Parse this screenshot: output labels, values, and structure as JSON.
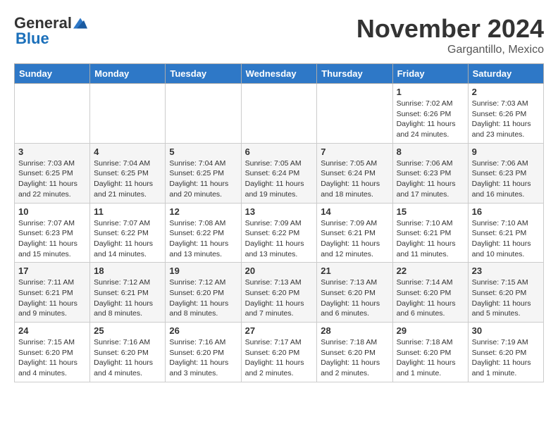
{
  "header": {
    "logo_general": "General",
    "logo_blue": "Blue",
    "month_title": "November 2024",
    "location": "Gargantillo, Mexico"
  },
  "days_of_week": [
    "Sunday",
    "Monday",
    "Tuesday",
    "Wednesday",
    "Thursday",
    "Friday",
    "Saturday"
  ],
  "weeks": [
    [
      {
        "day": "",
        "info": ""
      },
      {
        "day": "",
        "info": ""
      },
      {
        "day": "",
        "info": ""
      },
      {
        "day": "",
        "info": ""
      },
      {
        "day": "",
        "info": ""
      },
      {
        "day": "1",
        "info": "Sunrise: 7:02 AM\nSunset: 6:26 PM\nDaylight: 11 hours and 24 minutes."
      },
      {
        "day": "2",
        "info": "Sunrise: 7:03 AM\nSunset: 6:26 PM\nDaylight: 11 hours and 23 minutes."
      }
    ],
    [
      {
        "day": "3",
        "info": "Sunrise: 7:03 AM\nSunset: 6:25 PM\nDaylight: 11 hours and 22 minutes."
      },
      {
        "day": "4",
        "info": "Sunrise: 7:04 AM\nSunset: 6:25 PM\nDaylight: 11 hours and 21 minutes."
      },
      {
        "day": "5",
        "info": "Sunrise: 7:04 AM\nSunset: 6:25 PM\nDaylight: 11 hours and 20 minutes."
      },
      {
        "day": "6",
        "info": "Sunrise: 7:05 AM\nSunset: 6:24 PM\nDaylight: 11 hours and 19 minutes."
      },
      {
        "day": "7",
        "info": "Sunrise: 7:05 AM\nSunset: 6:24 PM\nDaylight: 11 hours and 18 minutes."
      },
      {
        "day": "8",
        "info": "Sunrise: 7:06 AM\nSunset: 6:23 PM\nDaylight: 11 hours and 17 minutes."
      },
      {
        "day": "9",
        "info": "Sunrise: 7:06 AM\nSunset: 6:23 PM\nDaylight: 11 hours and 16 minutes."
      }
    ],
    [
      {
        "day": "10",
        "info": "Sunrise: 7:07 AM\nSunset: 6:23 PM\nDaylight: 11 hours and 15 minutes."
      },
      {
        "day": "11",
        "info": "Sunrise: 7:07 AM\nSunset: 6:22 PM\nDaylight: 11 hours and 14 minutes."
      },
      {
        "day": "12",
        "info": "Sunrise: 7:08 AM\nSunset: 6:22 PM\nDaylight: 11 hours and 13 minutes."
      },
      {
        "day": "13",
        "info": "Sunrise: 7:09 AM\nSunset: 6:22 PM\nDaylight: 11 hours and 13 minutes."
      },
      {
        "day": "14",
        "info": "Sunrise: 7:09 AM\nSunset: 6:21 PM\nDaylight: 11 hours and 12 minutes."
      },
      {
        "day": "15",
        "info": "Sunrise: 7:10 AM\nSunset: 6:21 PM\nDaylight: 11 hours and 11 minutes."
      },
      {
        "day": "16",
        "info": "Sunrise: 7:10 AM\nSunset: 6:21 PM\nDaylight: 11 hours and 10 minutes."
      }
    ],
    [
      {
        "day": "17",
        "info": "Sunrise: 7:11 AM\nSunset: 6:21 PM\nDaylight: 11 hours and 9 minutes."
      },
      {
        "day": "18",
        "info": "Sunrise: 7:12 AM\nSunset: 6:21 PM\nDaylight: 11 hours and 8 minutes."
      },
      {
        "day": "19",
        "info": "Sunrise: 7:12 AM\nSunset: 6:20 PM\nDaylight: 11 hours and 8 minutes."
      },
      {
        "day": "20",
        "info": "Sunrise: 7:13 AM\nSunset: 6:20 PM\nDaylight: 11 hours and 7 minutes."
      },
      {
        "day": "21",
        "info": "Sunrise: 7:13 AM\nSunset: 6:20 PM\nDaylight: 11 hours and 6 minutes."
      },
      {
        "day": "22",
        "info": "Sunrise: 7:14 AM\nSunset: 6:20 PM\nDaylight: 11 hours and 6 minutes."
      },
      {
        "day": "23",
        "info": "Sunrise: 7:15 AM\nSunset: 6:20 PM\nDaylight: 11 hours and 5 minutes."
      }
    ],
    [
      {
        "day": "24",
        "info": "Sunrise: 7:15 AM\nSunset: 6:20 PM\nDaylight: 11 hours and 4 minutes."
      },
      {
        "day": "25",
        "info": "Sunrise: 7:16 AM\nSunset: 6:20 PM\nDaylight: 11 hours and 4 minutes."
      },
      {
        "day": "26",
        "info": "Sunrise: 7:16 AM\nSunset: 6:20 PM\nDaylight: 11 hours and 3 minutes."
      },
      {
        "day": "27",
        "info": "Sunrise: 7:17 AM\nSunset: 6:20 PM\nDaylight: 11 hours and 2 minutes."
      },
      {
        "day": "28",
        "info": "Sunrise: 7:18 AM\nSunset: 6:20 PM\nDaylight: 11 hours and 2 minutes."
      },
      {
        "day": "29",
        "info": "Sunrise: 7:18 AM\nSunset: 6:20 PM\nDaylight: 11 hours and 1 minute."
      },
      {
        "day": "30",
        "info": "Sunrise: 7:19 AM\nSunset: 6:20 PM\nDaylight: 11 hours and 1 minute."
      }
    ]
  ]
}
